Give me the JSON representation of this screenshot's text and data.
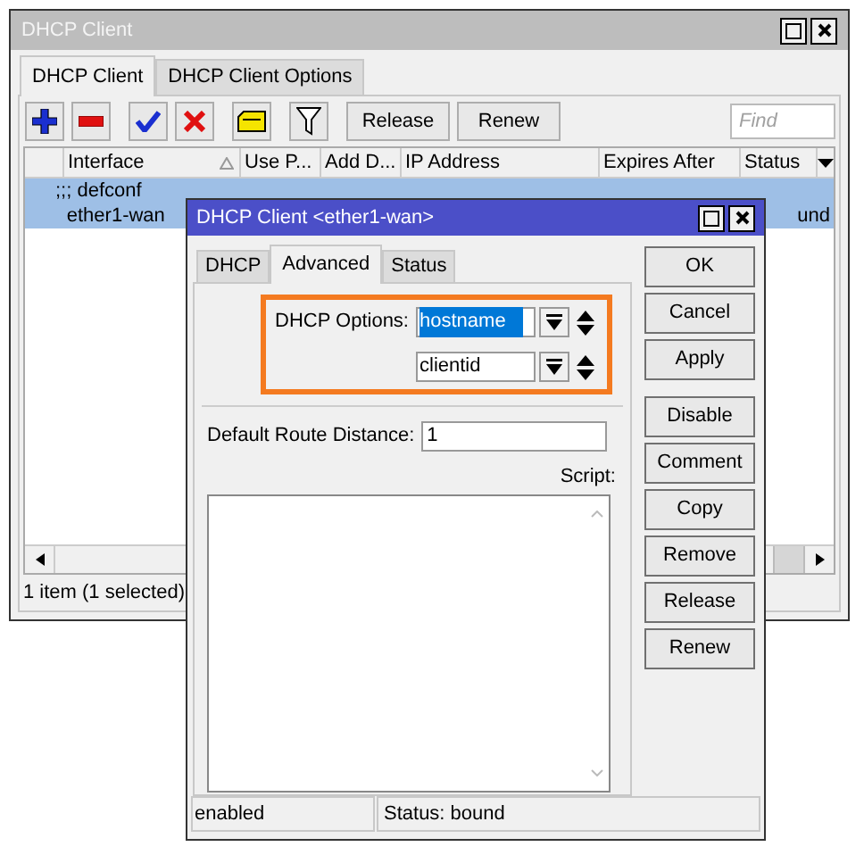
{
  "main_window": {
    "title": "DHCP Client",
    "tabs": [
      {
        "label": "DHCP Client",
        "selected": true
      },
      {
        "label": "DHCP Client Options",
        "selected": false
      }
    ],
    "toolbar": [
      {
        "kind": "add"
      },
      {
        "kind": "remove"
      },
      {
        "kind": "enable"
      },
      {
        "kind": "disable"
      },
      {
        "kind": "comment"
      },
      {
        "kind": "filter"
      }
    ],
    "text_buttons": [
      "Release",
      "Renew"
    ],
    "find": {
      "placeholder": "Find"
    },
    "table": {
      "columns": [
        {
          "label": "Interface",
          "sorted": true
        },
        {
          "label": "Use P...",
          "sorted": false
        },
        {
          "label": "Add D...",
          "sorted": false
        },
        {
          "label": "IP Address",
          "sorted": false
        },
        {
          "label": "Expires After",
          "sorted": false
        },
        {
          "label": "Status",
          "sorted": false
        }
      ],
      "rows": [
        {
          "kind": "comment",
          "text": ";;; defconf",
          "selected": true
        },
        {
          "kind": "item",
          "interface": "ether1-wan",
          "status": "und",
          "selected": true
        }
      ]
    },
    "status_bar": "1 item (1 selected)"
  },
  "dialog": {
    "title": "DHCP Client <ether1-wan>",
    "tabs": [
      {
        "label": "DHCP",
        "selected": false
      },
      {
        "label": "Advanced",
        "selected": true
      },
      {
        "label": "Status",
        "selected": false
      }
    ],
    "dhcp_options": {
      "label": "DHCP Options:",
      "highlighted": true,
      "values": [
        {
          "value": "hostname",
          "selected": true
        },
        {
          "value": "clientid",
          "selected": false
        }
      ]
    },
    "default_route_distance": {
      "label": "Default Route Distance:",
      "value": "1"
    },
    "script": {
      "label": "Script:"
    },
    "buttons": [
      "OK",
      "Cancel",
      "Apply",
      "Disable",
      "Comment",
      "Copy",
      "Remove",
      "Release",
      "Renew"
    ],
    "status_bar": [
      "enabled",
      "Status: bound"
    ]
  }
}
